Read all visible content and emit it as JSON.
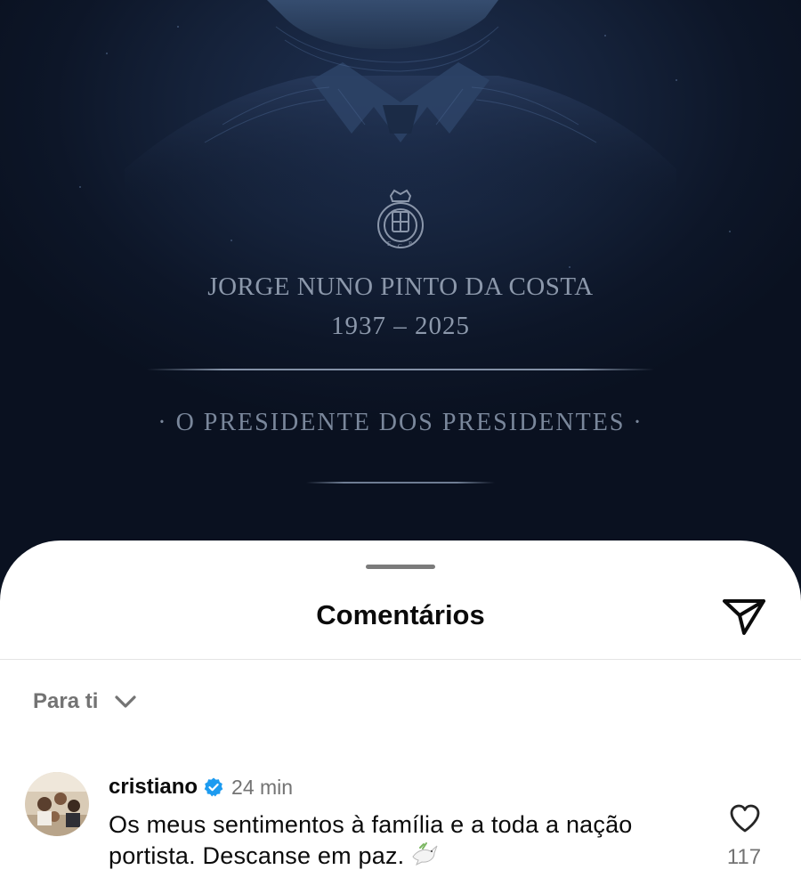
{
  "post": {
    "tribute_name": "JORGE NUNO PINTO DA COSTA",
    "tribute_years": "1937 – 2025",
    "tribute_motto": "· O PRESIDENTE DOS PRESIDENTES ·",
    "crest_icon": "fc-porto-crest-icon"
  },
  "comments_sheet": {
    "title": "Comentários",
    "share_icon": "send-icon",
    "sort": {
      "label": "Para ti",
      "icon": "chevron-down-icon"
    },
    "comments": [
      {
        "username": "cristiano",
        "verified": true,
        "timestamp": "24 min",
        "text": "Os meus sentimentos à família e a toda a nação portista. Descanse em paz.",
        "emoji_icon": "dove-icon",
        "like_icon": "heart-icon",
        "likes": "117"
      }
    ]
  },
  "colors": {
    "post_background": "#0b1322",
    "tribute_text": "#8c98ab",
    "sheet_background": "#ffffff",
    "secondary_text": "#737373",
    "verified_badge": "#1d9bf0"
  }
}
